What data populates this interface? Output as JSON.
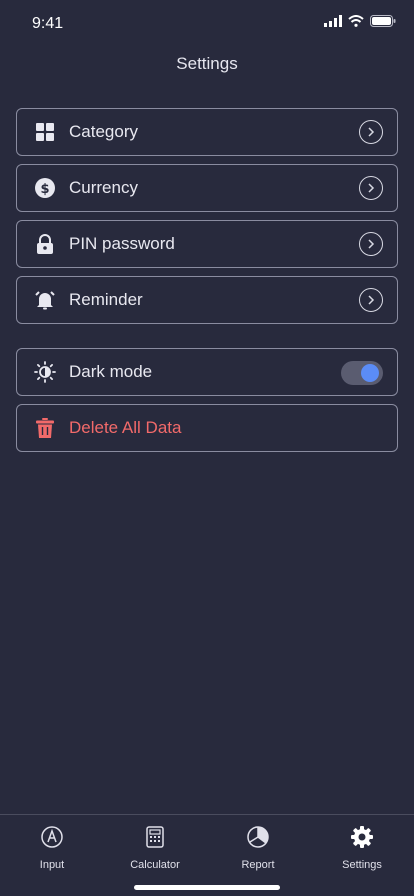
{
  "status_bar": {
    "time": "9:41"
  },
  "header": {
    "title": "Settings"
  },
  "menu": {
    "items": [
      {
        "label": "Category",
        "icon": "grid-icon"
      },
      {
        "label": "Currency",
        "icon": "dollar-icon"
      },
      {
        "label": "PIN password",
        "icon": "lock-icon"
      },
      {
        "label": "Reminder",
        "icon": "bell-icon"
      }
    ]
  },
  "dark_mode": {
    "label": "Dark mode",
    "enabled": true
  },
  "delete": {
    "label": "Delete All Data"
  },
  "tab_bar": {
    "tabs": [
      {
        "label": "Input",
        "icon": "pen-icon"
      },
      {
        "label": "Calculator",
        "icon": "calculator-icon"
      },
      {
        "label": "Report",
        "icon": "pie-chart-icon"
      },
      {
        "label": "Settings",
        "icon": "gear-icon"
      }
    ]
  },
  "colors": {
    "background": "#282a3d",
    "accent": "#5b8cf6",
    "danger": "#f26a6a"
  }
}
